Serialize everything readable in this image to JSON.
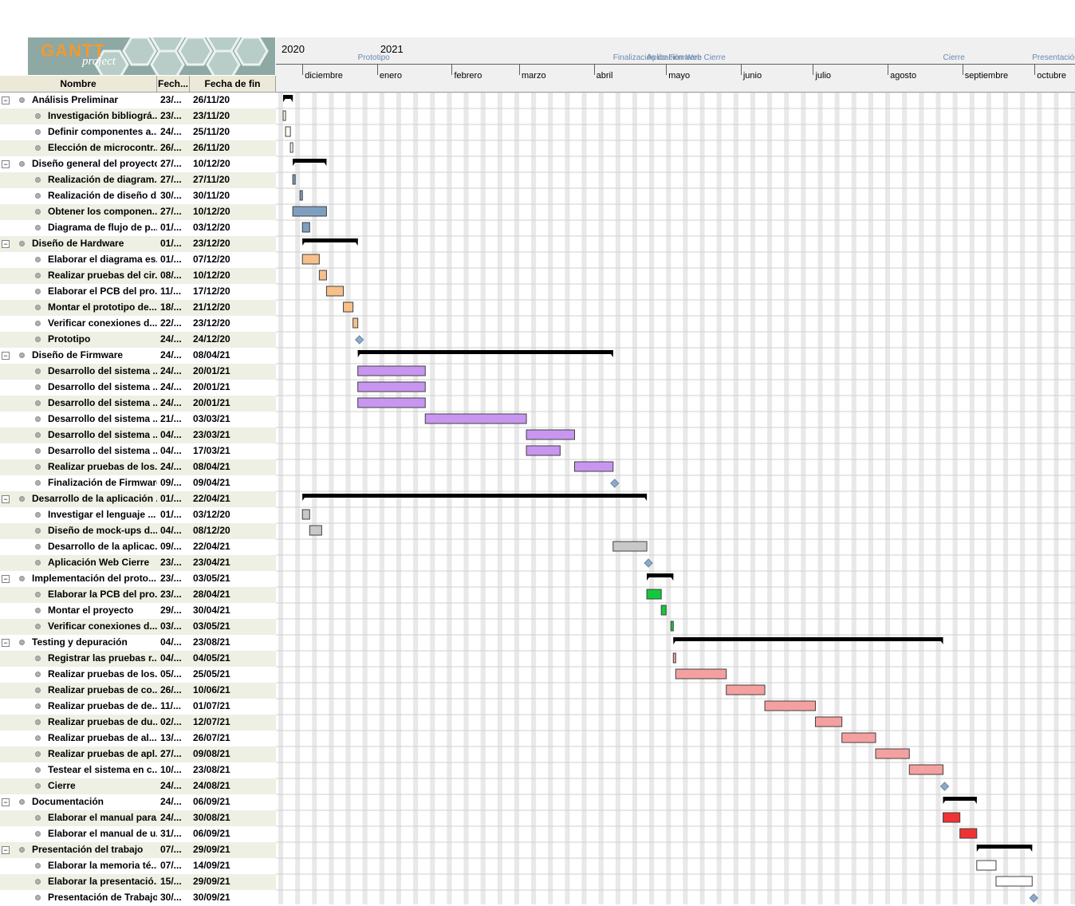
{
  "app": {
    "logo_text": "GANTT",
    "logo_sub": "project"
  },
  "columns": {
    "name": "Nombre",
    "start": "Fech...",
    "end": "Fecha de fin"
  },
  "timeline": {
    "years": [
      "2020",
      "2021"
    ],
    "months": [
      "diciembre",
      "enero",
      "febrero",
      "marzo",
      "abril",
      "mayo",
      "junio",
      "julio",
      "agosto",
      "septiembre",
      "octubre"
    ],
    "milestone_labels": [
      "Prototipo",
      "Finalización de Firmware",
      "Aplicación Web Cierre",
      "Cierre",
      "Presentación d"
    ]
  },
  "tasks": [
    {
      "level": 0,
      "name": "Análisis Preliminar",
      "start": "23/...",
      "end": "26/11/20",
      "kind": "summary",
      "s": "2020-11-23",
      "e": "2020-11-26"
    },
    {
      "level": 1,
      "name": "Investigación bibliográ...",
      "start": "23/...",
      "end": "23/11/20",
      "kind": "task",
      "color": "#fffff0",
      "s": "2020-11-23",
      "e": "2020-11-23"
    },
    {
      "level": 1,
      "name": "Definir componentes a...",
      "start": "24/...",
      "end": "25/11/20",
      "kind": "task",
      "color": "#fffff0",
      "s": "2020-11-24",
      "e": "2020-11-25"
    },
    {
      "level": 1,
      "name": "Elección de microcontr...",
      "start": "26/...",
      "end": "26/11/20",
      "kind": "task",
      "color": "#fffff0",
      "s": "2020-11-26",
      "e": "2020-11-26"
    },
    {
      "level": 0,
      "name": "Diseño general del proyecto",
      "start": "27/...",
      "end": "10/12/20",
      "kind": "summary",
      "s": "2020-11-27",
      "e": "2020-12-10"
    },
    {
      "level": 1,
      "name": "Realización de diagram...",
      "start": "27/...",
      "end": "27/11/20",
      "kind": "task",
      "color": "#7f9fbf",
      "s": "2020-11-27",
      "e": "2020-11-27"
    },
    {
      "level": 1,
      "name": "Realización de diseño d...",
      "start": "30/...",
      "end": "30/11/20",
      "kind": "task",
      "color": "#7f9fbf",
      "s": "2020-11-30",
      "e": "2020-11-30"
    },
    {
      "level": 1,
      "name": "Obtener los componen...",
      "start": "27/...",
      "end": "10/12/20",
      "kind": "task",
      "color": "#7f9fbf",
      "s": "2020-11-27",
      "e": "2020-12-10"
    },
    {
      "level": 1,
      "name": "Diagrama de flujo de p...",
      "start": "01/...",
      "end": "03/12/20",
      "kind": "task",
      "color": "#7f9fbf",
      "s": "2020-12-01",
      "e": "2020-12-03"
    },
    {
      "level": 0,
      "name": "Diseño de Hardware",
      "start": "01/...",
      "end": "23/12/20",
      "kind": "summary",
      "s": "2020-12-01",
      "e": "2020-12-23"
    },
    {
      "level": 1,
      "name": "Elaborar el diagrama es...",
      "start": "01/...",
      "end": "07/12/20",
      "kind": "task",
      "color": "#f7c08a",
      "s": "2020-12-01",
      "e": "2020-12-07"
    },
    {
      "level": 1,
      "name": "Realizar pruebas del cir...",
      "start": "08/...",
      "end": "10/12/20",
      "kind": "task",
      "color": "#f7c08a",
      "s": "2020-12-08",
      "e": "2020-12-10"
    },
    {
      "level": 1,
      "name": "Elaborar el PCB del pro...",
      "start": "11/...",
      "end": "17/12/20",
      "kind": "task",
      "color": "#f7c08a",
      "s": "2020-12-11",
      "e": "2020-12-17"
    },
    {
      "level": 1,
      "name": "Montar el prototipo de...",
      "start": "18/...",
      "end": "21/12/20",
      "kind": "task",
      "color": "#f7c08a",
      "s": "2020-12-18",
      "e": "2020-12-21"
    },
    {
      "level": 1,
      "name": "Verificar conexiones d...",
      "start": "22/...",
      "end": "23/12/20",
      "kind": "task",
      "color": "#f7c08a",
      "s": "2020-12-22",
      "e": "2020-12-23"
    },
    {
      "level": 1,
      "name": "Prototipo",
      "start": "24/...",
      "end": "24/12/20",
      "kind": "milestone",
      "s": "2020-12-24",
      "e": "2020-12-24"
    },
    {
      "level": 0,
      "name": "Diseño de Firmware",
      "start": "24/...",
      "end": "08/04/21",
      "kind": "summary",
      "s": "2020-12-24",
      "e": "2021-04-08"
    },
    {
      "level": 1,
      "name": "Desarrollo del sistema ...",
      "start": "24/...",
      "end": "20/01/21",
      "kind": "task",
      "color": "#c896f0",
      "s": "2020-12-24",
      "e": "2021-01-20"
    },
    {
      "level": 1,
      "name": "Desarrollo del sistema ...",
      "start": "24/...",
      "end": "20/01/21",
      "kind": "task",
      "color": "#c896f0",
      "s": "2020-12-24",
      "e": "2021-01-20"
    },
    {
      "level": 1,
      "name": "Desarrollo del sistema ...",
      "start": "24/...",
      "end": "20/01/21",
      "kind": "task",
      "color": "#c896f0",
      "s": "2020-12-24",
      "e": "2021-01-20"
    },
    {
      "level": 1,
      "name": "Desarrollo del sistema ...",
      "start": "21/...",
      "end": "03/03/21",
      "kind": "task",
      "color": "#c896f0",
      "s": "2021-01-21",
      "e": "2021-03-03"
    },
    {
      "level": 1,
      "name": "Desarrollo del sistema ...",
      "start": "04/...",
      "end": "23/03/21",
      "kind": "task",
      "color": "#c896f0",
      "s": "2021-03-04",
      "e": "2021-03-23"
    },
    {
      "level": 1,
      "name": "Desarrollo del sistema ...",
      "start": "04/...",
      "end": "17/03/21",
      "kind": "task",
      "color": "#c896f0",
      "s": "2021-03-04",
      "e": "2021-03-17"
    },
    {
      "level": 1,
      "name": "Realizar pruebas de los...",
      "start": "24/...",
      "end": "08/04/21",
      "kind": "task",
      "color": "#c896f0",
      "s": "2021-03-24",
      "e": "2021-04-08"
    },
    {
      "level": 1,
      "name": "Finalización de Firmware",
      "start": "09/...",
      "end": "09/04/21",
      "kind": "milestone",
      "s": "2021-04-09",
      "e": "2021-04-09"
    },
    {
      "level": 0,
      "name": "Desarrollo de la aplicación ...",
      "start": "01/...",
      "end": "22/04/21",
      "kind": "summary",
      "s": "2020-12-01",
      "e": "2021-04-22"
    },
    {
      "level": 1,
      "name": "Investigar el lenguaje ...",
      "start": "01/...",
      "end": "03/12/20",
      "kind": "task",
      "color": "#c8c8c8",
      "s": "2020-12-01",
      "e": "2020-12-03"
    },
    {
      "level": 1,
      "name": "Diseño de mock-ups d...",
      "start": "04/...",
      "end": "08/12/20",
      "kind": "task",
      "color": "#c8c8c8",
      "s": "2020-12-04",
      "e": "2020-12-08"
    },
    {
      "level": 1,
      "name": "Desarrollo de la aplicac...",
      "start": "09/...",
      "end": "22/04/21",
      "kind": "task",
      "color": "#c8c8c8",
      "s": "2021-04-09",
      "e": "2021-04-22"
    },
    {
      "level": 1,
      "name": "Aplicación Web Cierre",
      "start": "23/...",
      "end": "23/04/21",
      "kind": "milestone",
      "s": "2021-04-23",
      "e": "2021-04-23"
    },
    {
      "level": 0,
      "name": "Implementación del proto...",
      "start": "23/...",
      "end": "03/05/21",
      "kind": "summary",
      "s": "2021-04-23",
      "e": "2021-05-03"
    },
    {
      "level": 1,
      "name": "Elaborar la PCB del pro...",
      "start": "23/...",
      "end": "28/04/21",
      "kind": "task",
      "color": "#14c83c",
      "s": "2021-04-23",
      "e": "2021-04-28"
    },
    {
      "level": 1,
      "name": "Montar el proyecto",
      "start": "29/...",
      "end": "30/04/21",
      "kind": "task",
      "color": "#14c83c",
      "s": "2021-04-29",
      "e": "2021-04-30"
    },
    {
      "level": 1,
      "name": "Verificar conexiones d...",
      "start": "03/...",
      "end": "03/05/21",
      "kind": "task",
      "color": "#14c83c",
      "s": "2021-05-03",
      "e": "2021-05-03"
    },
    {
      "level": 0,
      "name": "Testing y depuración",
      "start": "04/...",
      "end": "23/08/21",
      "kind": "summary",
      "s": "2021-05-04",
      "e": "2021-08-23"
    },
    {
      "level": 1,
      "name": "Registrar las pruebas r...",
      "start": "04/...",
      "end": "04/05/21",
      "kind": "task",
      "color": "#f5a0a0",
      "s": "2021-05-04",
      "e": "2021-05-04"
    },
    {
      "level": 1,
      "name": "Realizar pruebas de los...",
      "start": "05/...",
      "end": "25/05/21",
      "kind": "task",
      "color": "#f5a0a0",
      "s": "2021-05-05",
      "e": "2021-05-25"
    },
    {
      "level": 1,
      "name": "Realizar pruebas de co...",
      "start": "26/...",
      "end": "10/06/21",
      "kind": "task",
      "color": "#f5a0a0",
      "s": "2021-05-26",
      "e": "2021-06-10"
    },
    {
      "level": 1,
      "name": "Realizar pruebas de de...",
      "start": "11/...",
      "end": "01/07/21",
      "kind": "task",
      "color": "#f5a0a0",
      "s": "2021-06-11",
      "e": "2021-07-01"
    },
    {
      "level": 1,
      "name": "Realizar pruebas de du...",
      "start": "02/...",
      "end": "12/07/21",
      "kind": "task",
      "color": "#f5a0a0",
      "s": "2021-07-02",
      "e": "2021-07-12"
    },
    {
      "level": 1,
      "name": "Realizar pruebas de al...",
      "start": "13/...",
      "end": "26/07/21",
      "kind": "task",
      "color": "#f5a0a0",
      "s": "2021-07-13",
      "e": "2021-07-26"
    },
    {
      "level": 1,
      "name": "Realizar pruebas de apl...",
      "start": "27/...",
      "end": "09/08/21",
      "kind": "task",
      "color": "#f5a0a0",
      "s": "2021-07-27",
      "e": "2021-08-09"
    },
    {
      "level": 1,
      "name": "Testear el sistema en c...",
      "start": "10/...",
      "end": "23/08/21",
      "kind": "task",
      "color": "#f5a0a0",
      "s": "2021-08-10",
      "e": "2021-08-23"
    },
    {
      "level": 1,
      "name": "Cierre",
      "start": "24/...",
      "end": "24/08/21",
      "kind": "milestone",
      "s": "2021-08-24",
      "e": "2021-08-24"
    },
    {
      "level": 0,
      "name": "Documentación",
      "start": "24/...",
      "end": "06/09/21",
      "kind": "summary",
      "s": "2021-08-24",
      "e": "2021-09-06"
    },
    {
      "level": 1,
      "name": "Elaborar el manual para...",
      "start": "24/...",
      "end": "30/08/21",
      "kind": "task",
      "color": "#f03232",
      "s": "2021-08-24",
      "e": "2021-08-30"
    },
    {
      "level": 1,
      "name": "Elaborar el manual de u...",
      "start": "31/...",
      "end": "06/09/21",
      "kind": "task",
      "color": "#f03232",
      "s": "2021-08-31",
      "e": "2021-09-06"
    },
    {
      "level": 0,
      "name": "Presentación del trabajo",
      "start": "07/...",
      "end": "29/09/21",
      "kind": "summary",
      "s": "2021-09-07",
      "e": "2021-09-29"
    },
    {
      "level": 1,
      "name": "Elaborar la memoria té...",
      "start": "07/...",
      "end": "14/09/21",
      "kind": "task",
      "color": "#ffffff",
      "s": "2021-09-07",
      "e": "2021-09-14"
    },
    {
      "level": 1,
      "name": "Elaborar la presentació...",
      "start": "15/...",
      "end": "29/09/21",
      "kind": "task",
      "color": "#ffffff",
      "s": "2021-09-15",
      "e": "2021-09-29"
    },
    {
      "level": 1,
      "name": "Presentación de Trabajo",
      "start": "30/...",
      "end": "30/09/21",
      "kind": "milestone",
      "s": "2021-09-30",
      "e": "2021-09-30"
    }
  ],
  "colors": {
    "summary": "#000000",
    "milestone": "#8fa8c8",
    "row_alt": "#eef0e4",
    "weekend": "#e8e8e8"
  }
}
